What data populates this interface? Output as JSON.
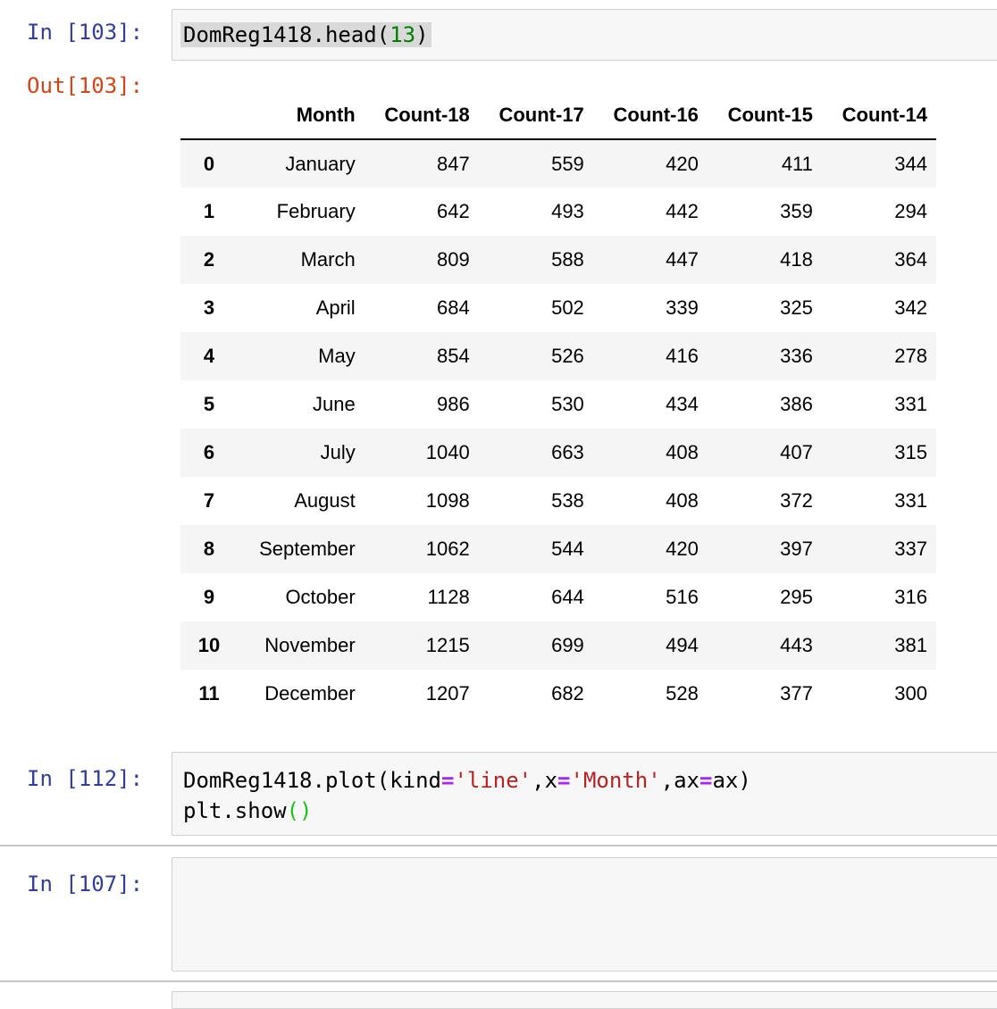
{
  "cells": {
    "c103": {
      "in_prompt": "In [103]:",
      "out_prompt": "Out[103]:",
      "code": {
        "obj": "DomReg1418.head(",
        "num": "13",
        "close": ")"
      }
    },
    "c112": {
      "in_prompt": "In [112]:",
      "line1": {
        "a": "DomReg1418.plot(kind",
        "eq1": "=",
        "s1": "'line'",
        "b": ",x",
        "eq2": "=",
        "s2": "'Month'",
        "c": ",ax",
        "eq3": "=",
        "d": "ax)"
      },
      "line2": {
        "a": "plt.show",
        "paren": "()"
      }
    },
    "c107": {
      "in_prompt": "In [107]:",
      "code": ""
    }
  },
  "table": {
    "columns": [
      "",
      "Month",
      "Count-18",
      "Count-17",
      "Count-16",
      "Count-15",
      "Count-14"
    ],
    "rows": [
      [
        "0",
        "January",
        "847",
        "559",
        "420",
        "411",
        "344"
      ],
      [
        "1",
        "February",
        "642",
        "493",
        "442",
        "359",
        "294"
      ],
      [
        "2",
        "March",
        "809",
        "588",
        "447",
        "418",
        "364"
      ],
      [
        "3",
        "April",
        "684",
        "502",
        "339",
        "325",
        "342"
      ],
      [
        "4",
        "May",
        "854",
        "526",
        "416",
        "336",
        "278"
      ],
      [
        "5",
        "June",
        "986",
        "530",
        "434",
        "386",
        "331"
      ],
      [
        "6",
        "July",
        "1040",
        "663",
        "408",
        "407",
        "315"
      ],
      [
        "7",
        "August",
        "1098",
        "538",
        "408",
        "372",
        "331"
      ],
      [
        "8",
        "September",
        "1062",
        "544",
        "420",
        "397",
        "337"
      ],
      [
        "9",
        "October",
        "1128",
        "644",
        "516",
        "295",
        "316"
      ],
      [
        "10",
        "November",
        "1215",
        "699",
        "494",
        "443",
        "381"
      ],
      [
        "11",
        "December",
        "1207",
        "682",
        "528",
        "377",
        "300"
      ]
    ]
  },
  "colors": {
    "in_prompt": "#303f9f",
    "out_prompt": "#d84315",
    "cell_bg": "#f7f7f7",
    "string": "#ba2121",
    "number": "#008000",
    "operator": "#aa22ff"
  }
}
